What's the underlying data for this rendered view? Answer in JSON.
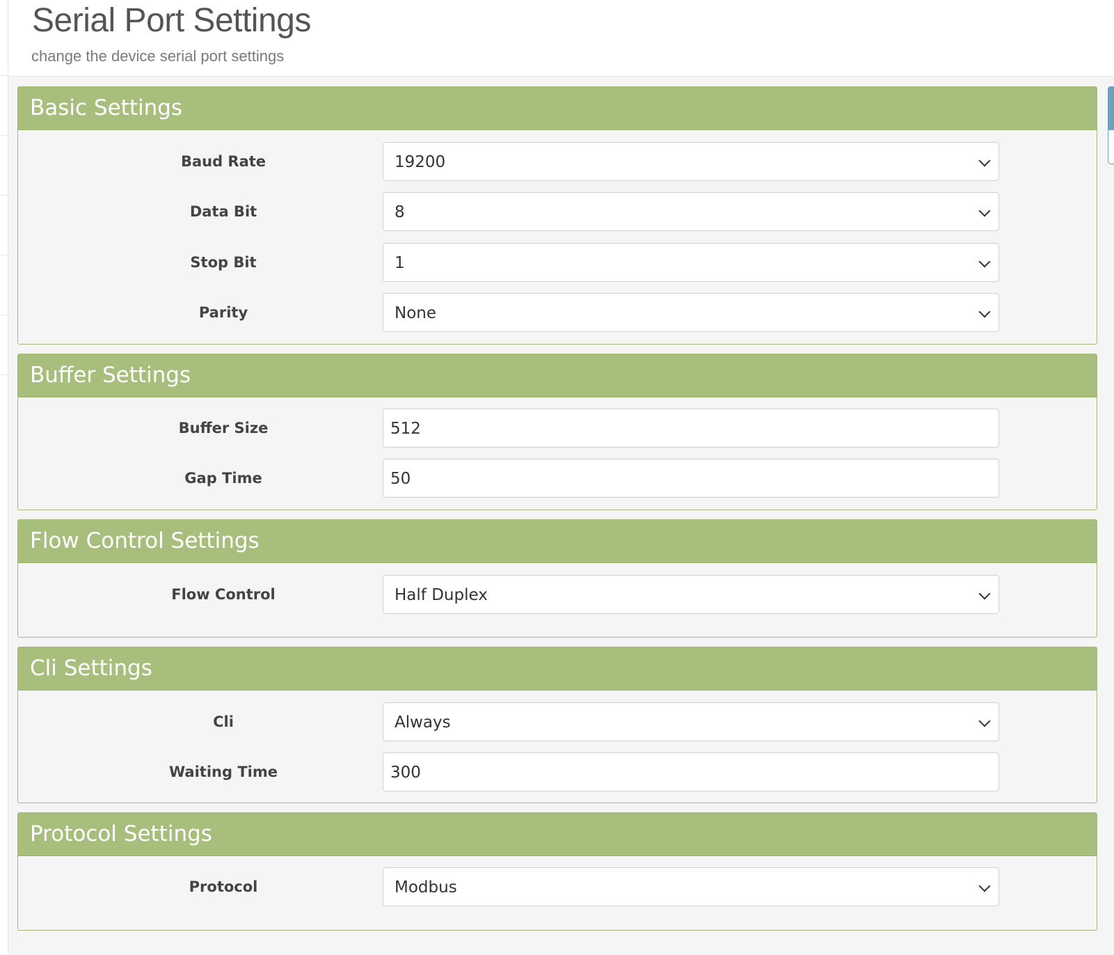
{
  "header": {
    "title": "Serial Port Settings",
    "subtitle": "change the device serial port settings"
  },
  "panels": {
    "basic": {
      "title": "Basic Settings",
      "baud_rate": {
        "label": "Baud Rate",
        "value": "19200"
      },
      "data_bit": {
        "label": "Data Bit",
        "value": "8"
      },
      "stop_bit": {
        "label": "Stop Bit",
        "value": "1"
      },
      "parity": {
        "label": "Parity",
        "value": "None"
      }
    },
    "buffer": {
      "title": "Buffer Settings",
      "buffer_size": {
        "label": "Buffer Size",
        "value": "512"
      },
      "gap_time": {
        "label": "Gap Time",
        "value": "50"
      }
    },
    "flow": {
      "title": "Flow Control Settings",
      "flow_control": {
        "label": "Flow Control",
        "value": "Half Duplex"
      }
    },
    "cli": {
      "title": "Cli Settings",
      "cli": {
        "label": "Cli",
        "value": "Always"
      },
      "waiting_time": {
        "label": "Waiting Time",
        "value": "300"
      }
    },
    "protocol": {
      "title": "Protocol Settings",
      "protocol": {
        "label": "Protocol",
        "value": "Modbus"
      }
    }
  },
  "colors": {
    "panel_header": "#a8be7d",
    "panel_border": "#a5bb7b",
    "page_background": "#f4f5f4",
    "side_tab": "#6fa1bf"
  },
  "icons": {
    "select_arrow": "chevron-down-icon"
  }
}
